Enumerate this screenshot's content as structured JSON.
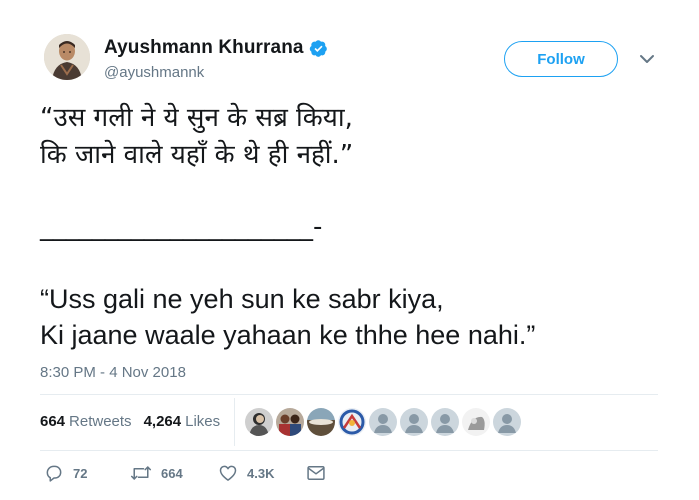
{
  "author": {
    "display_name": "Ayushmann Khurrana",
    "handle": "@ayushmannk",
    "verified": true,
    "avatar_icon": "avatar-photo"
  },
  "header": {
    "follow_label": "Follow",
    "menu_icon": "chevron-down-icon"
  },
  "tweet": {
    "hindi_text": "“उस गली ने ये सुन के सब्र किया,\nकि जाने वाले यहाँ के थे ही नहीं.”",
    "divider": "_____________________-",
    "latin_text": "“Uss gali ne yeh sun ke sabr kiya,\nKi jaane waale yahaan ke thhe hee nahi.”",
    "timestamp": "8:30 PM - 4 Nov 2018"
  },
  "stats": {
    "retweets_count": "664",
    "retweets_label": "Retweets",
    "likes_count": "4,264",
    "likes_label": "Likes",
    "liker_avatars": [
      "photo",
      "photo",
      "photo",
      "photo",
      "default",
      "default",
      "default",
      "photo",
      "default"
    ]
  },
  "actions": {
    "reply_count": "72",
    "retweet_count": "664",
    "like_count": "4.3K",
    "reply_icon": "reply-icon",
    "retweet_icon": "retweet-icon",
    "like_icon": "heart-icon",
    "dm_icon": "envelope-icon"
  },
  "colors": {
    "accent": "#1da1f2",
    "text": "#14171a",
    "muted": "#657786",
    "border": "#e6ecf0"
  }
}
